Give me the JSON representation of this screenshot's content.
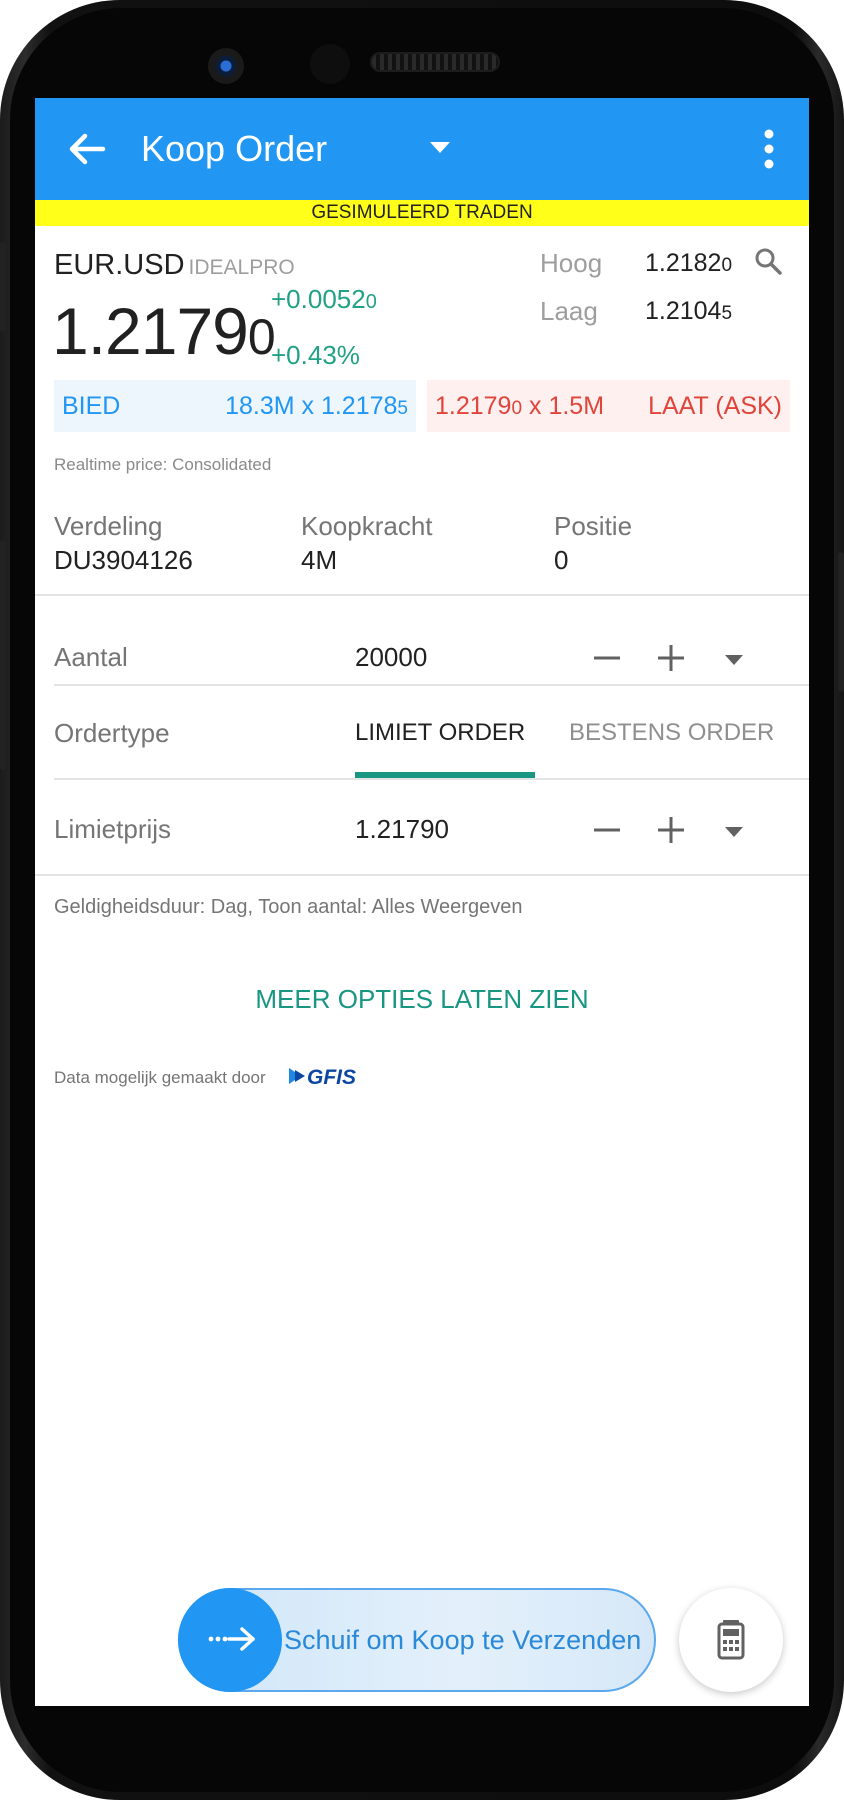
{
  "appbar": {
    "title": "Koop Order",
    "back_icon": "arrow-left-icon",
    "dropdown_icon": "triangle-down-icon",
    "menu_icon": "more-vertical-icon",
    "color": "#2196f3"
  },
  "banner": {
    "text": "GESIMULEERD TRADEN",
    "color": "#ffff1a"
  },
  "quote": {
    "symbol": "EUR.USD",
    "exchange": "IDEALPRO",
    "last_main": "1.2179",
    "last_small": "0",
    "change_main": "+0.0052",
    "change_small": "0",
    "change_pct": "+0.43%",
    "high_label": "Hoog",
    "high_main": "1.2182",
    "high_small": "0",
    "low_label": "Laag",
    "low_main": "1.2104",
    "low_small": "5",
    "bid_label": "BIED",
    "bid_main": "18.3M x 1.2178",
    "bid_small": "5",
    "ask_main": "1.2179",
    "ask_small": "0",
    "ask_rest": " x 1.5M",
    "ask_label": "LAAT (ASK)",
    "realtime": "Realtime price: Consolidated",
    "up_color": "#21a185",
    "bid_color": "#2196f3",
    "ask_color": "#e0443a"
  },
  "account": {
    "allocation_label": "Verdeling",
    "allocation_value": "DU3904126",
    "buying_power_label": "Koopkracht",
    "buying_power_value": "4M",
    "position_label": "Positie",
    "position_value": "0"
  },
  "order": {
    "quantity_label": "Aantal",
    "quantity_value": "20000",
    "ordertype_label": "Ordertype",
    "tab_limit": "LIMIET ORDER",
    "tab_market": "BESTENS ORDER",
    "limit_label": "Limietprijs",
    "limit_value": "1.21790",
    "validity": "Geldigheidsduur: Dag, Toon aantal: Alles Weergeven",
    "more_options": "MEER OPTIES LATEN ZIEN",
    "accent_color": "#199682"
  },
  "footer": {
    "data_by": "Data mogelijk gemaakt door",
    "logo_text": "GFIS",
    "slide_label": "Schuif om Koop te Verzenden",
    "slide_icon": "dotted-arrow-right-icon",
    "calc_icon": "calculator-icon"
  }
}
